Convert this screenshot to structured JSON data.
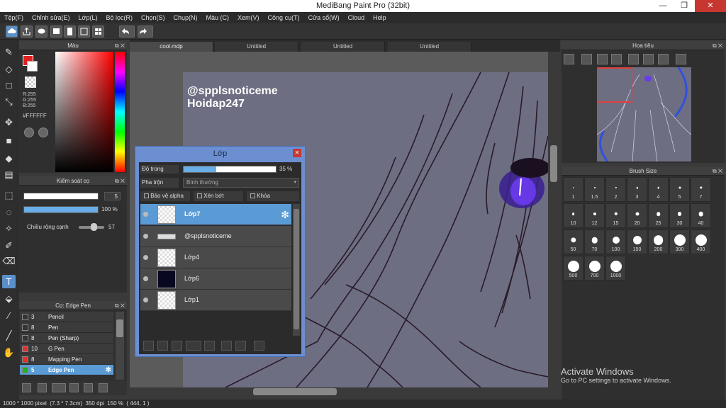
{
  "window": {
    "title": "MediBang Paint Pro (32bit)",
    "minimize": "—",
    "maximize": "❐",
    "close": "✕"
  },
  "menu": [
    "Tệp(F)",
    "Chỉnh sửa(E)",
    "Lớp(L)",
    "Bộ lọc(R)",
    "Chọn(S)",
    "Chụp(N)",
    "Màu (C)",
    "Xem(V)",
    "Công cụ(T)",
    "Cửa sổ(W)",
    "Cloud",
    "Help"
  ],
  "color_panel": {
    "title": "Màu",
    "r": "R:255",
    "g": "G:255",
    "b": "B:255",
    "hex": "#FFFFFF"
  },
  "brush_control": {
    "title": "Kiểm soát cọ",
    "size": "5",
    "opacity": "100 %",
    "width_label": "Chiều rộng cạnh",
    "width_value": "57"
  },
  "brush_list": {
    "title": "Cọ: Edge Pen",
    "items": [
      {
        "size": "3",
        "name": "Pencil",
        "color": "#333333"
      },
      {
        "size": "8",
        "name": "Pen",
        "color": "#333333"
      },
      {
        "size": "8",
        "name": "Pen (Sharp)",
        "color": "#333333"
      },
      {
        "size": "10",
        "name": "G Pen",
        "color": "#e03030"
      },
      {
        "size": "8",
        "name": "Mapping Pen",
        "color": "#e03030"
      },
      {
        "size": "5",
        "name": "Edge Pen",
        "color": "#20b020"
      }
    ]
  },
  "doc_tabs": [
    "cool.mdp",
    "Untitled",
    "Untitled",
    "Untitled"
  ],
  "canvas": {
    "watermark_line1": "@spplsnoticeme",
    "watermark_line2": "Hoidap247"
  },
  "layer_panel": {
    "title": "Lớp",
    "opacity_label": "Độ trong",
    "opacity_value": "35 %",
    "opacity_fraction": 0.35,
    "blend_label": "Pha trộn",
    "blend_value": "Bình thường",
    "protect_alpha": "Bảo vệ alpha",
    "clipping": "Xén bớt",
    "lock": "Khóa",
    "layers": [
      {
        "name": "Lớp7",
        "selected": true
      },
      {
        "name": "@spplsnoticeme",
        "selected": false
      },
      {
        "name": "Lớp4",
        "selected": false
      },
      {
        "name": "Lớp6",
        "selected": false
      },
      {
        "name": "Lớp1",
        "selected": false
      }
    ]
  },
  "navigator": {
    "title": "Hoa tiêu"
  },
  "brush_size": {
    "title": "Brush Size",
    "sizes": [
      "1",
      "1.5",
      "2",
      "3",
      "4",
      "5",
      "7",
      "10",
      "12",
      "15",
      "20",
      "25",
      "30",
      "40",
      "50",
      "70",
      "100",
      "150",
      "200",
      "300",
      "400",
      "500",
      "700",
      "1000"
    ]
  },
  "status": {
    "dims": "1000 * 1000 pixel",
    "cm": "(7.3 * 7.3cm)",
    "dpi": "350 dpi",
    "zoom": "150 %",
    "coords": "( 444, 1 )"
  },
  "activate": {
    "line1": "Activate Windows",
    "line2": "Go to PC settings to activate Windows."
  }
}
